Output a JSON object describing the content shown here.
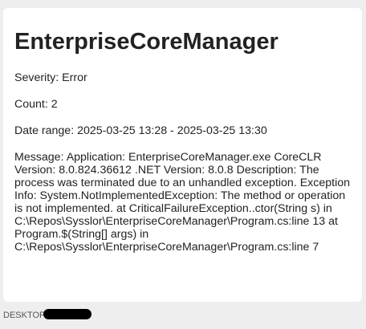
{
  "card": {
    "title": "EnterpriseCoreManager",
    "severity_label": "Severity:",
    "severity_value": "Error",
    "count_label": "Count:",
    "count_value": "2",
    "date_range_label": "Date range:",
    "date_range_value": "2025-03-25 13:28 - 2025-03-25 13:30",
    "message_label": "Message:",
    "message_value": "Application: EnterpriseCoreManager.exe CoreCLR Version: 8.0.824.36612 .NET Version: 8.0.8 Description: The process was terminated due to an unhandled exception. Exception Info: System.NotImplementedException: The method or operation is not implemented. at CriticalFailureException..ctor(String s) in C:\\Repos\\Sysslor\\EnterpriseCoreManager\\Program.cs:line 13 at Program.$(String[] args) in C:\\Repos\\Sysslor\\EnterpriseCoreManager\\Program.cs:line 7"
  },
  "footer": {
    "machine_prefix": "DESKTOP"
  },
  "colors": {
    "background": "#eeeeee",
    "card": "#ffffff",
    "redaction": "#000000"
  }
}
